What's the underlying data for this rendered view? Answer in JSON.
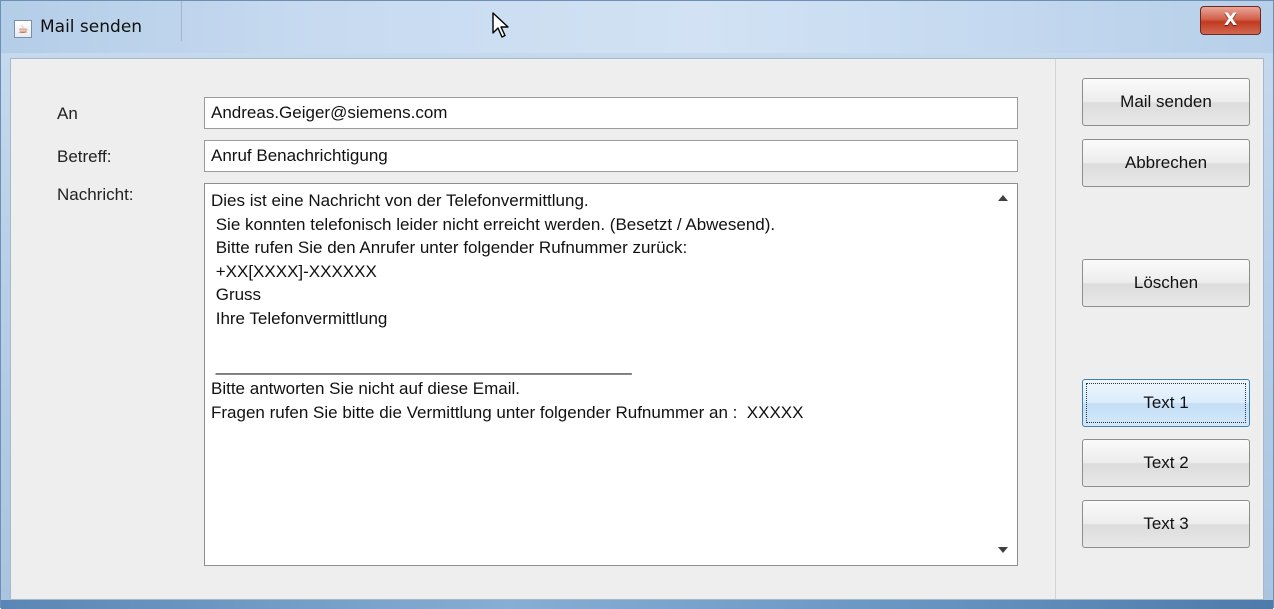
{
  "window": {
    "title": "Mail senden",
    "close_label": "X"
  },
  "form": {
    "to_label": "An",
    "to_value": "Andreas.Geiger@siemens.com",
    "subject_label": "Betreff:",
    "subject_value": "Anruf Benachrichtigung",
    "message_label": "Nachricht:",
    "message_lines": [
      "Dies ist eine Nachricht von der Telefonvermittlung.",
      " Sie konnten telefonisch leider nicht erreicht werden. (Besetzt / Abwesend).",
      " Bitte rufen Sie den Anrufer unter folgender Rufnummer zurück:",
      " +XX[XXXX]-XXXXXX",
      " Gruss",
      " Ihre Telefonvermittlung",
      "",
      " ____________________________________________",
      "Bitte antworten Sie nicht auf diese Email.",
      "Fragen rufen Sie bitte die Vermittlung unter folgender Rufnummer an :  XXXXX"
    ]
  },
  "buttons": {
    "send": "Mail senden",
    "cancel": "Abbrechen",
    "clear": "Löschen",
    "text1": "Text 1",
    "text2": "Text 2",
    "text3": "Text 3"
  },
  "icons": {
    "app": "java-coffee-cup-icon",
    "cursor": "mouse-pointer-icon",
    "close": "close-icon",
    "scroll_up": "scroll-up-arrow-icon",
    "scroll_down": "scroll-down-arrow-icon"
  },
  "colors": {
    "close_button": "#c13a21",
    "focused_button": "#c4def6",
    "client_background": "#eeeeee"
  }
}
